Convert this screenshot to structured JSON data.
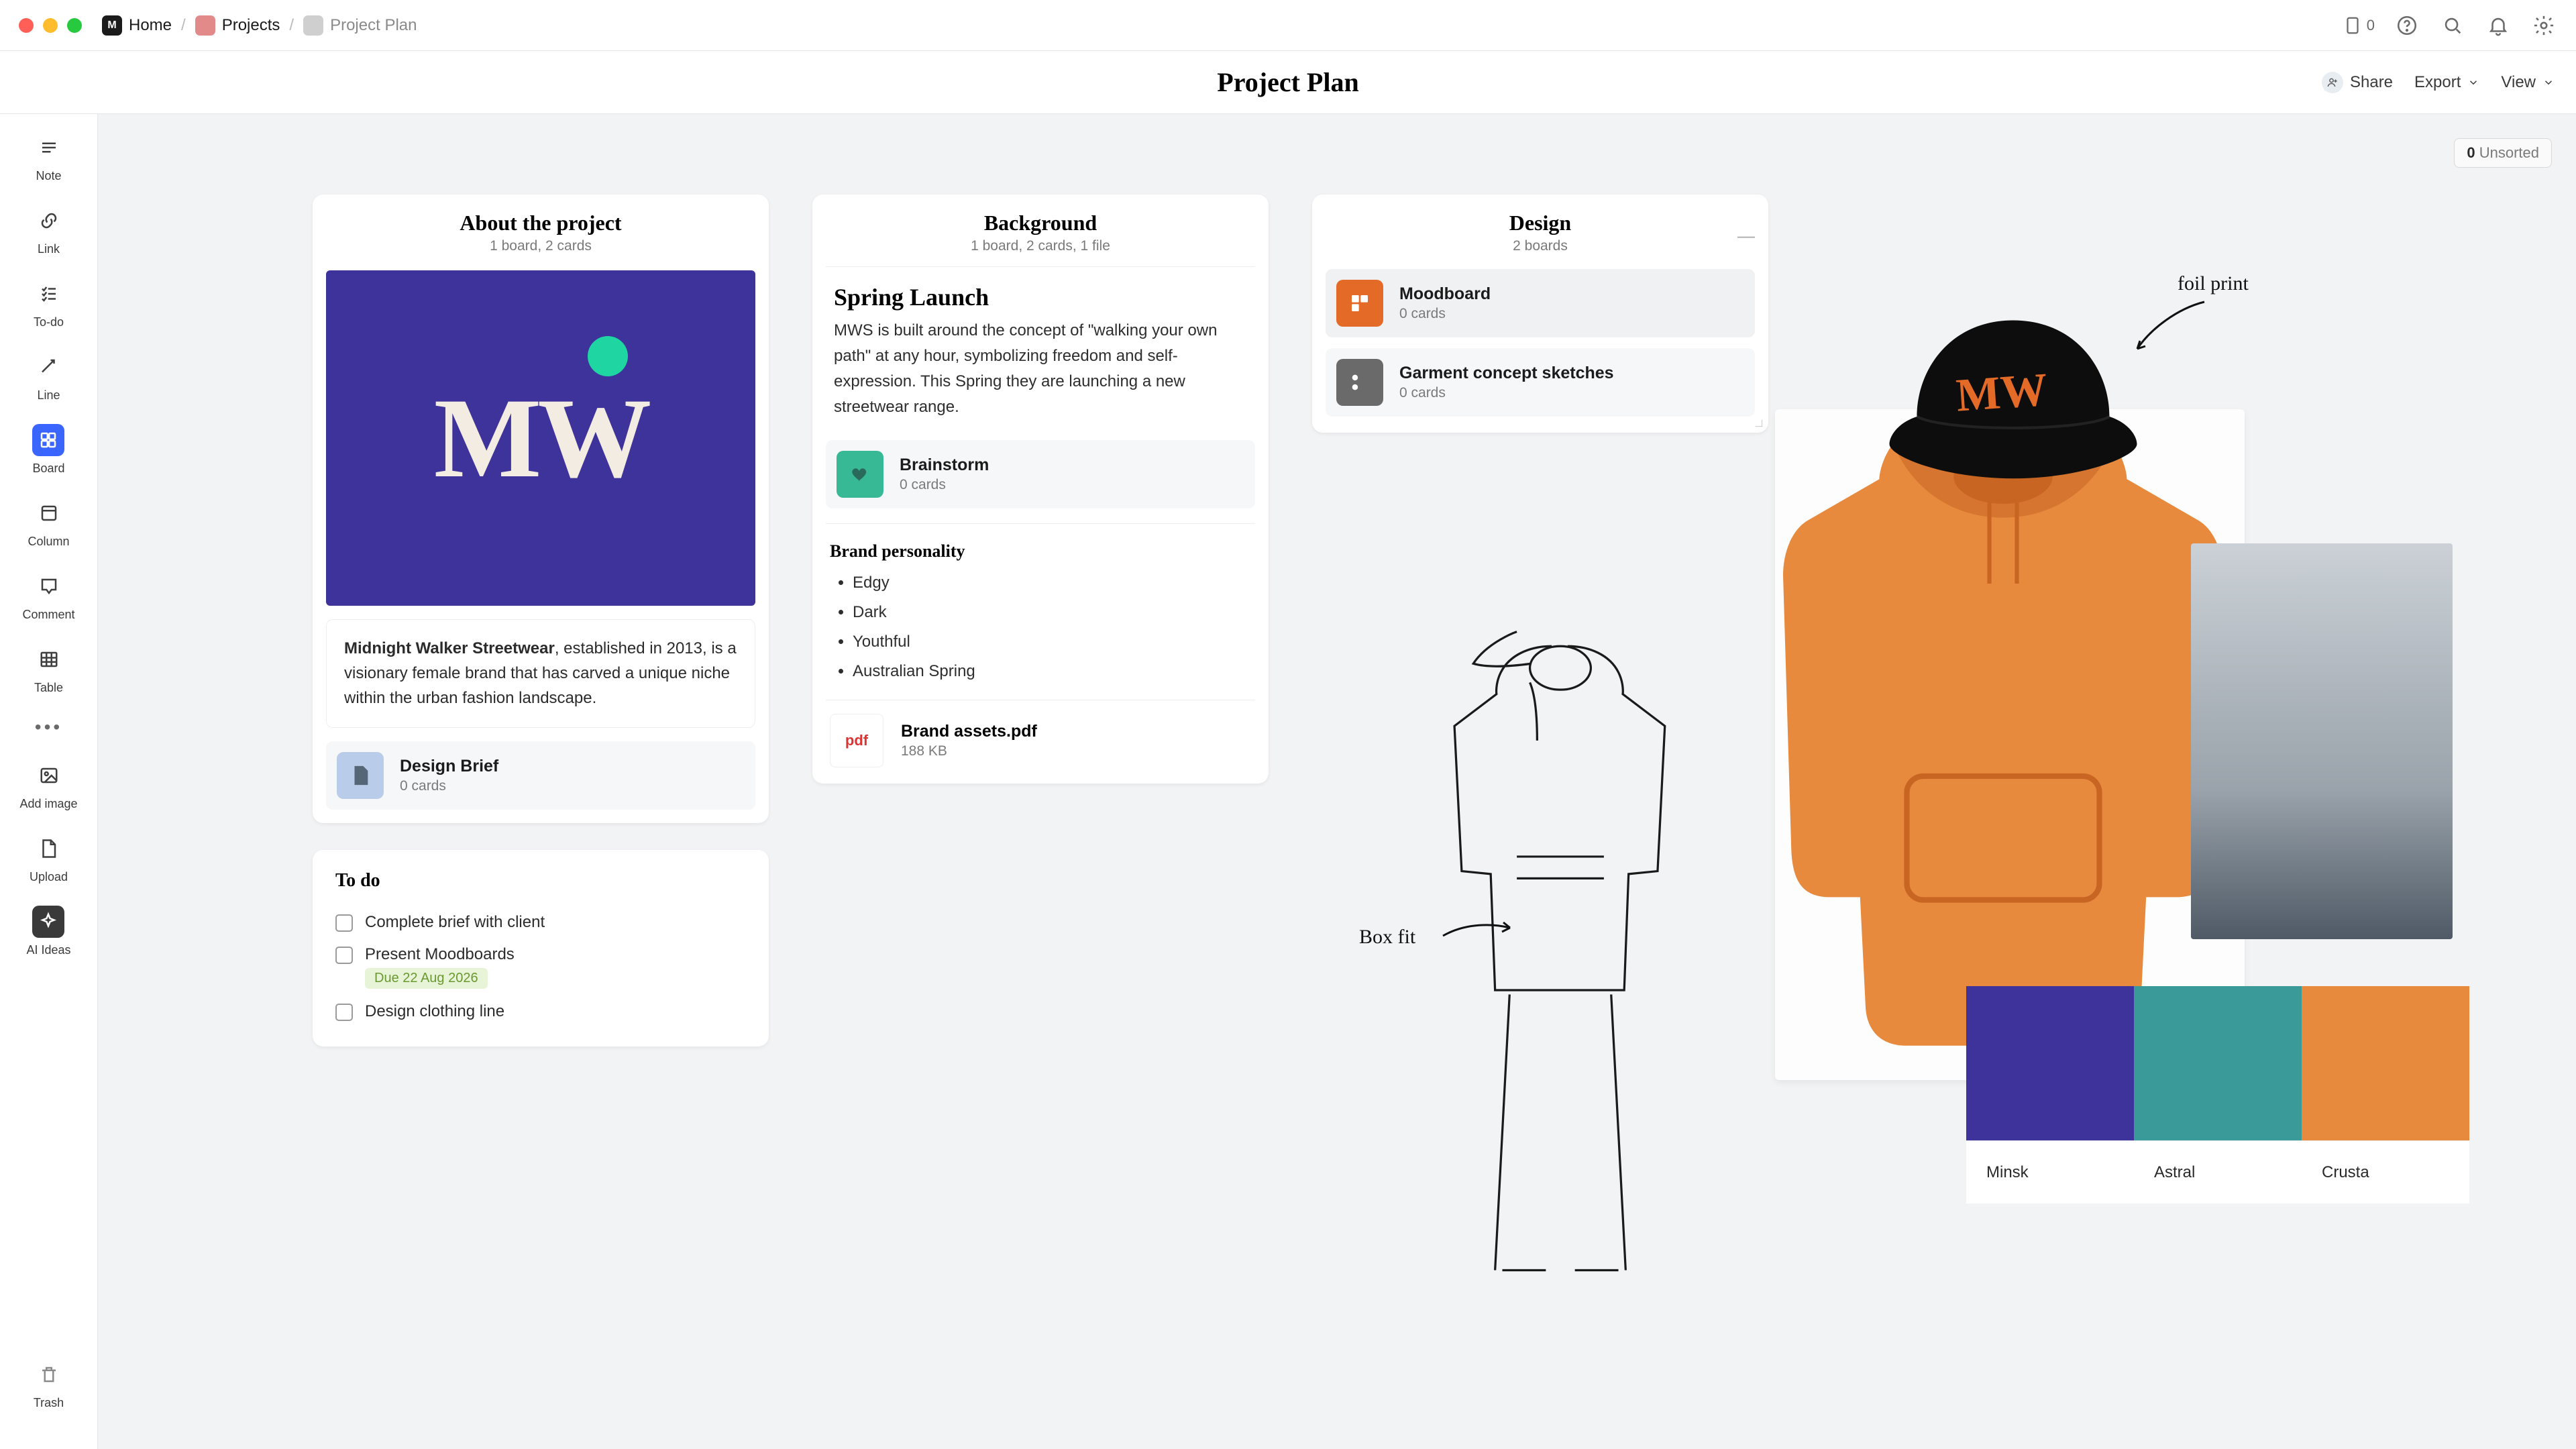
{
  "breadcrumb": {
    "home": "Home",
    "projects": "Projects",
    "plan": "Project Plan"
  },
  "titlebar": {
    "doc_count": "0"
  },
  "subheader": {
    "title": "Project Plan",
    "share": "Share",
    "export": "Export",
    "view": "View"
  },
  "unsorted": {
    "count": "0",
    "label": "Unsorted"
  },
  "rail": {
    "note": "Note",
    "link": "Link",
    "todo": "To-do",
    "line": "Line",
    "board": "Board",
    "column": "Column",
    "comment": "Comment",
    "table": "Table",
    "add_image": "Add image",
    "upload": "Upload",
    "ai": "AI Ideas",
    "trash": "Trash"
  },
  "about": {
    "title": "About the project",
    "sub": "1 board, 2 cards",
    "logo": "MW",
    "text_bold": "Midnight Walker Streetwear",
    "text_rest": ", established in 2013, is a visionary female brand that has carved a unique niche within the urban fashion landscape.",
    "brief": {
      "title": "Design Brief",
      "sub": "0 cards"
    }
  },
  "todo": {
    "title": "To do",
    "items": [
      {
        "label": "Complete brief with client"
      },
      {
        "label": "Present Moodboards",
        "due": "Due 22 Aug 2026"
      },
      {
        "label": "Design clothing line"
      }
    ]
  },
  "background": {
    "title": "Background",
    "sub": "1 board, 2 cards, 1 file",
    "heading": "Spring Launch",
    "para": "MWS is built around the concept of \"walking your own path\" at any hour, symbolizing freedom and self-expression. This Spring they are launching a new streetwear range.",
    "brainstorm": {
      "title": "Brainstorm",
      "sub": "0 cards"
    },
    "brand_title": "Brand personality",
    "brand_items": [
      "Edgy",
      "Dark",
      "Youthful",
      "Australian Spring"
    ],
    "file": {
      "title": "Brand assets.pdf",
      "sub": "188 KB",
      "badge": "pdf"
    }
  },
  "design": {
    "title": "Design",
    "sub": "2 boards",
    "moodboard": {
      "title": "Moodboard",
      "sub": "0 cards"
    },
    "sketches": {
      "title": "Garment concept sketches",
      "sub": "0 cards"
    }
  },
  "mood": {
    "note_foil": "foil print",
    "note_boxfit": "Box fit",
    "hat_logo": "MW",
    "swatches": [
      {
        "name": "Minsk",
        "hex": "#3e339a"
      },
      {
        "name": "Astral",
        "hex": "#3a9a9a"
      },
      {
        "name": "Crusta",
        "hex": "#e78a3e"
      }
    ]
  }
}
